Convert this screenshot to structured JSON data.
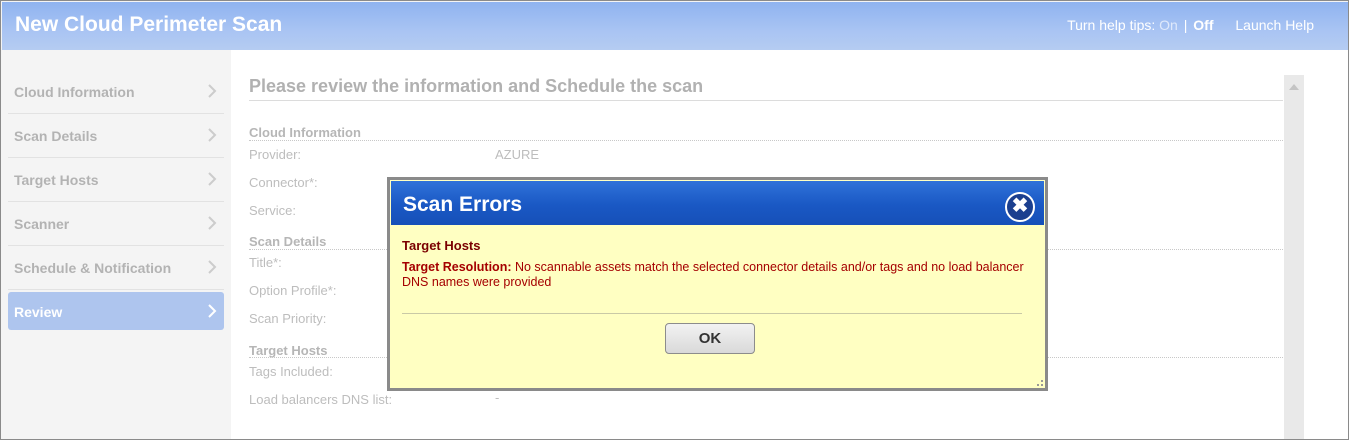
{
  "header": {
    "title": "New Cloud Perimeter Scan",
    "help_prefix": "Turn help tips:",
    "help_on": "On",
    "help_sep": "|",
    "help_off": "Off",
    "launch_help": "Launch Help"
  },
  "sidebar": {
    "items": [
      {
        "label": "Cloud Information"
      },
      {
        "label": "Scan Details"
      },
      {
        "label": "Target Hosts"
      },
      {
        "label": "Scanner"
      },
      {
        "label": "Schedule & Notification"
      },
      {
        "label": "Review"
      }
    ],
    "active_index": 5
  },
  "main": {
    "heading": "Please review the information and Schedule the scan",
    "cloud_info": {
      "title": "Cloud Information",
      "provider_label": "Provider:",
      "provider_value": "AZURE",
      "connector_label": "Connector*:",
      "service_label": "Service:"
    },
    "scan_details": {
      "title": "Scan Details",
      "title_label": "Title*:",
      "option_profile_label": "Option Profile*:",
      "scan_priority_label": "Scan Priority:"
    },
    "target_hosts": {
      "title": "Target Hosts",
      "tags_label": "Tags Included:",
      "dns_label": "Load balancers DNS list:",
      "dns_value": "-"
    }
  },
  "dialog": {
    "title": "Scan Errors",
    "close_glyph": "✖",
    "subtitle": "Target Hosts",
    "message_label": "Target Resolution:",
    "message_text": "No scannable assets match the selected connector details and/or tags and no load balancer DNS names were provided",
    "ok_label": "OK"
  },
  "colors": {
    "header_bg": "#a9c4f3",
    "dialog_header": "#1a58c4",
    "dialog_bg": "#ffffc2",
    "error_text": "#a50000",
    "active_nav": "#aec5ee"
  }
}
